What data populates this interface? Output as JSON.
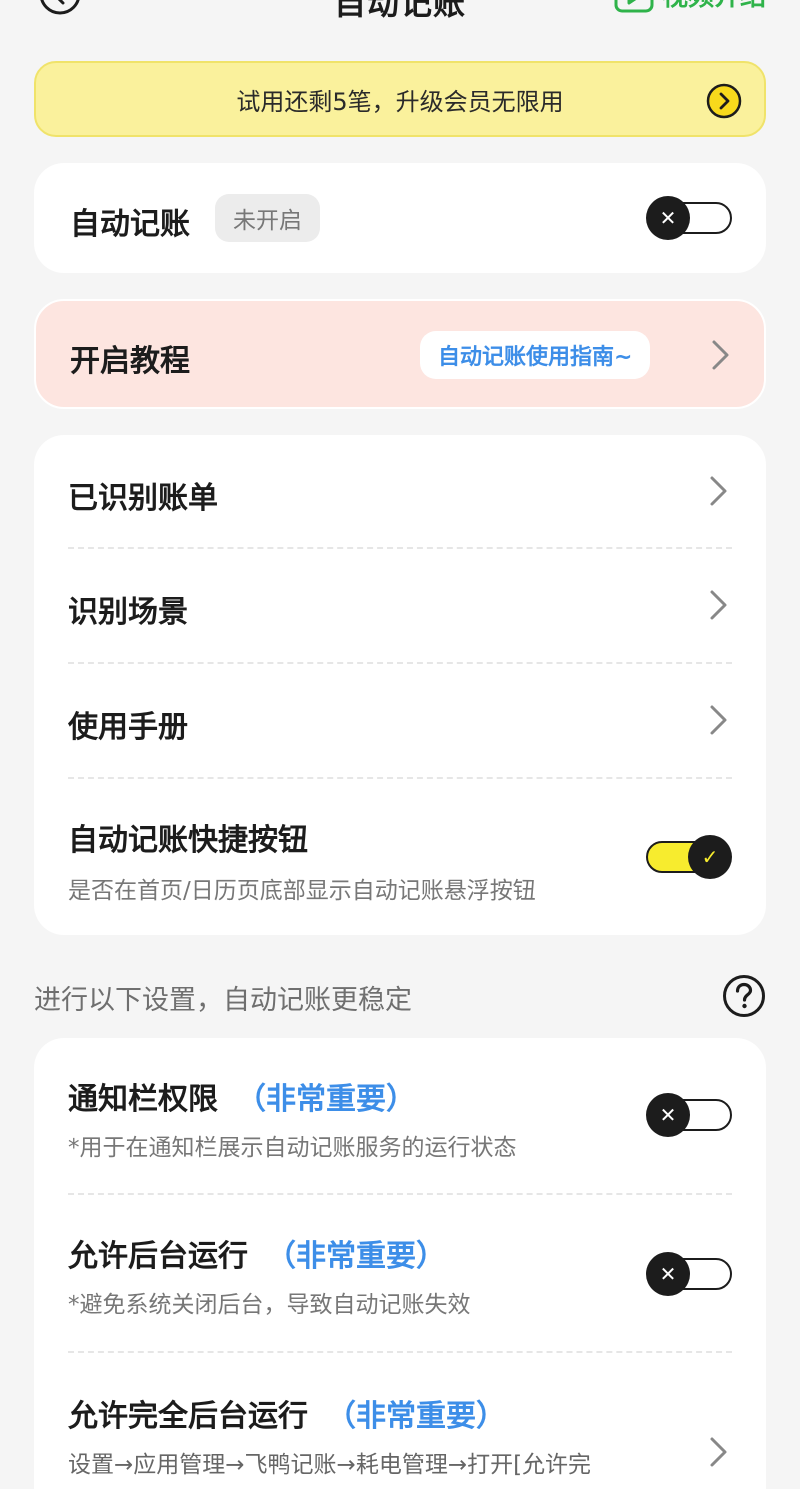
{
  "header": {
    "title": "自动记账",
    "video_label": "视频介绍"
  },
  "trial_banner": {
    "text": "试用还剩5笔，升级会员无限用"
  },
  "auto_bookkeeping": {
    "label": "自动记账",
    "status": "未开启",
    "enabled": false
  },
  "tutorial": {
    "label": "开启教程",
    "guide_label": "自动记账使用指南~"
  },
  "menu": {
    "items": [
      {
        "label": "已识别账单"
      },
      {
        "label": "识别场景"
      },
      {
        "label": "使用手册"
      }
    ],
    "shortcut": {
      "title": "自动记账快捷按钮",
      "desc": "是否在首页/日历页底部显示自动记账悬浮按钮",
      "enabled": true
    }
  },
  "section_hint": "进行以下设置，自动记账更稳定",
  "permissions": {
    "important_tag": "（非常重要）",
    "items": [
      {
        "title": "通知栏权限",
        "desc": "*用于在通知栏展示自动记账服务的运行状态",
        "enabled": false
      },
      {
        "title": "允许后台运行",
        "desc": "*避免系统关闭后台，导致自动记账失效",
        "enabled": false
      },
      {
        "title": "允许完全后台运行",
        "desc": "设置→应用管理→飞鸭记账→耗电管理→打开[允许完"
      }
    ]
  },
  "colors": {
    "accent_blue": "#3d8ee8",
    "accent_green": "#2fb34a",
    "banner_yellow": "#faf19c",
    "toggle_on": "#f7ec2e",
    "tutorial_bg": "#fde5e0"
  }
}
